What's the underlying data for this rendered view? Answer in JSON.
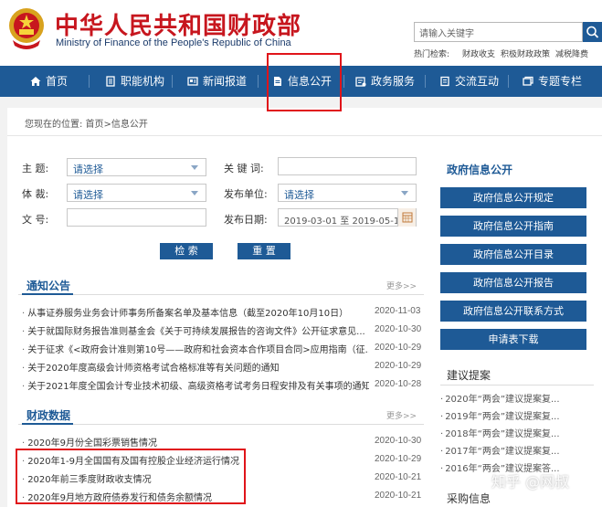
{
  "header": {
    "title_cn": "中华人民共和国财政部",
    "title_en": "Ministry of Finance of the People's Republic of China",
    "search_placeholder": "请输入关键字",
    "hot_label": "热门检索:",
    "hot_links": [
      "财政收支",
      "积极财政政策",
      "减税降费"
    ]
  },
  "nav": {
    "items": [
      {
        "label": "首页",
        "icon": "home-icon"
      },
      {
        "label": "职能机构",
        "icon": "document-icon"
      },
      {
        "label": "新闻报道",
        "icon": "newspaper-icon"
      },
      {
        "label": "信息公开",
        "icon": "file-icon"
      },
      {
        "label": "政务服务",
        "icon": "service-icon"
      },
      {
        "label": "交流互动",
        "icon": "chat-icon"
      },
      {
        "label": "专题专栏",
        "icon": "window-icon"
      }
    ]
  },
  "breadcrumb": "您现在的位置:  首页>信息公开",
  "form": {
    "subject_label": "主    题:",
    "subject_value": "请选择",
    "keyword_label": "关 键 词:",
    "genre_label": "体    裁:",
    "genre_value": "请选择",
    "unit_label": "发布单位:",
    "unit_value": "请选择",
    "docno_label": "文    号:",
    "date_label": "发布日期:",
    "date_value": "2019-03-01 至 2019-05-15",
    "search_btn": "检 索",
    "reset_btn": "重 置"
  },
  "notices": {
    "title": "通知公告",
    "more": "更多>>",
    "items": [
      {
        "text": "从事证券服务业务会计师事务所备案名单及基本信息（截至2020年10月10日）",
        "date": "2020-11-03"
      },
      {
        "text": "关于就国际财务报告准则基金会《关于可持续发展报告的咨询文件》公开征求意见...",
        "date": "2020-10-30"
      },
      {
        "text": "关于征求《<政府会计准则第10号——政府和社会资本合作项目合同>应用指南（征...",
        "date": "2020-10-29"
      },
      {
        "text": "关于2020年度高级会计师资格考试合格标准等有关问题的通知",
        "date": "2020-10-29"
      },
      {
        "text": "关于2021年度全国会计专业技术初级、高级资格考试考务日程安排及有关事项的通知",
        "date": "2020-10-28"
      }
    ]
  },
  "fiscal": {
    "title": "财政数据",
    "more": "更多>>",
    "items": [
      {
        "text": "2020年9月份全国彩票销售情况",
        "date": "2020-10-30"
      },
      {
        "text": "2020年1-9月全国国有及国有控股企业经济运行情况",
        "date": "2020-10-29"
      },
      {
        "text": "2020年前三季度财政收支情况",
        "date": "2020-10-21"
      },
      {
        "text": "2020年9月地方政府债券发行和债务余额情况",
        "date": "2020-10-21"
      }
    ]
  },
  "right": {
    "title": "政府信息公开",
    "buttons": [
      "政府信息公开规定",
      "政府信息公开指南",
      "政府信息公开目录",
      "政府信息公开报告",
      "政府信息公开联系方式",
      "申请表下载"
    ],
    "proposal_title": "建议提案",
    "proposals": [
      "2020年“两会”建议提案复...",
      "2019年“两会”建议提案复...",
      "2018年“两会”建议提案复...",
      "2017年“两会”建议提案复...",
      "2016年“两会”建议提案答..."
    ],
    "procurement_title": "采购信息"
  },
  "watermark": "知乎 @网叔",
  "colors": {
    "brand_red": "#c7161e",
    "nav_blue": "#1e5a96",
    "highlight_red": "#e0141a"
  }
}
